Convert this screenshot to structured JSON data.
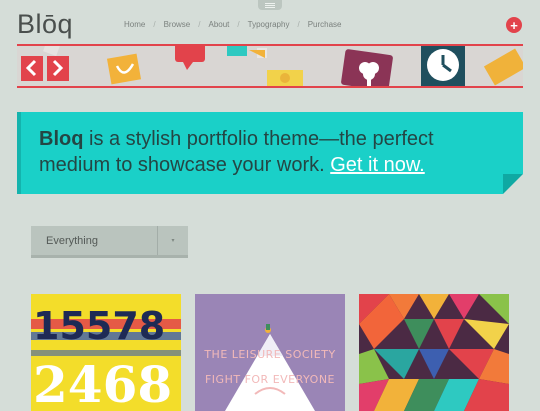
{
  "header": {
    "logo": "Blōq",
    "nav": [
      "Home",
      "Browse",
      "About",
      "Typography",
      "Purchase"
    ],
    "nav_separator": "/",
    "plus_symbol": "+"
  },
  "callout": {
    "brand": "Bloq",
    "text": " is a stylish portfolio theme—the perfect medium to showcase your work. ",
    "link": "Get it now."
  },
  "filter": {
    "selected": "Everything",
    "arrow": "▾"
  },
  "thumbnails": [
    {
      "lines": [
        "15578",
        "2468"
      ]
    },
    {
      "lines": [
        "THE LEISURE SOCIETY",
        "FIGHT FOR EVERYONE"
      ]
    },
    {
      "lines": []
    }
  ],
  "colors": {
    "accent": "#e2434b",
    "callout_bg": "#1ad0c8",
    "page_bg": "#d5ddd8"
  }
}
